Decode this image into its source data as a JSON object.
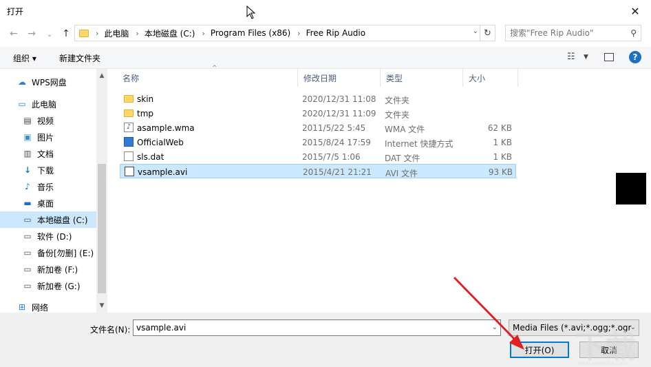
{
  "window": {
    "title": "打开",
    "close_glyph": "✕"
  },
  "nav": {
    "back_glyph": "←",
    "forward_glyph": "→",
    "recent_glyph": "⌄",
    "up_glyph": "↑",
    "breadcrumbs": [
      "此电脑",
      "本地磁盘 (C:)",
      "Program Files (x86)",
      "Free Rip Audio"
    ],
    "search_placeholder": "搜索\"Free Rip Audio\""
  },
  "toolbar": {
    "organize_label": "组织 ▾",
    "new_folder_label": "新建文件夹"
  },
  "sidebar": {
    "items": [
      {
        "label": "WPS网盘",
        "icon": "cloud-icon"
      },
      {
        "label": "此电脑",
        "icon": "computer-icon"
      },
      {
        "label": "视频",
        "icon": "video-folder-icon"
      },
      {
        "label": "图片",
        "icon": "pictures-folder-icon"
      },
      {
        "label": "文档",
        "icon": "documents-folder-icon"
      },
      {
        "label": "下载",
        "icon": "download-icon"
      },
      {
        "label": "音乐",
        "icon": "music-icon"
      },
      {
        "label": "桌面",
        "icon": "desktop-icon"
      },
      {
        "label": "本地磁盘 (C:)",
        "icon": "drive-icon",
        "selected": true
      },
      {
        "label": "软件 (D:)",
        "icon": "drive-icon"
      },
      {
        "label": "备份[勿删] (E:)",
        "icon": "drive-icon"
      },
      {
        "label": "新加卷 (F:)",
        "icon": "drive-icon"
      },
      {
        "label": "新加卷 (G:)",
        "icon": "drive-icon"
      },
      {
        "label": "网络",
        "icon": "network-icon"
      }
    ]
  },
  "columns": {
    "name": "名称",
    "date": "修改日期",
    "type": "类型",
    "size": "大小"
  },
  "files": [
    {
      "name": "skin",
      "date": "2020/12/31 11:08",
      "type": "文件夹",
      "size": "",
      "icon": "folder-icon"
    },
    {
      "name": "tmp",
      "date": "2020/12/31 11:09",
      "type": "文件夹",
      "size": "",
      "icon": "folder-icon"
    },
    {
      "name": "asample.wma",
      "date": "2011/5/22 5:45",
      "type": "WMA 文件",
      "size": "62 KB",
      "icon": "music-file-icon"
    },
    {
      "name": "OfficialWeb",
      "date": "2015/8/24 17:59",
      "type": "Internet 快捷方式",
      "size": "1 KB",
      "icon": "web-shortcut-icon"
    },
    {
      "name": "sls.dat",
      "date": "2015/7/5 1:06",
      "type": "DAT 文件",
      "size": "1 KB",
      "icon": "file-icon"
    },
    {
      "name": "vsample.avi",
      "date": "2015/4/21 21:21",
      "type": "AVI 文件",
      "size": "93 KB",
      "icon": "video-file-icon",
      "selected": true
    }
  ],
  "footer": {
    "filename_label": "文件名(N):",
    "filename_value": "vsample.avi",
    "filter_value": "Media Files (*.avi;*.ogg;*.ogr",
    "open_label": "打开(O)",
    "cancel_label": "取消"
  },
  "colors": {
    "selection": "#cce8ff",
    "accent": "#0078d7",
    "arrow": "#e02020"
  }
}
